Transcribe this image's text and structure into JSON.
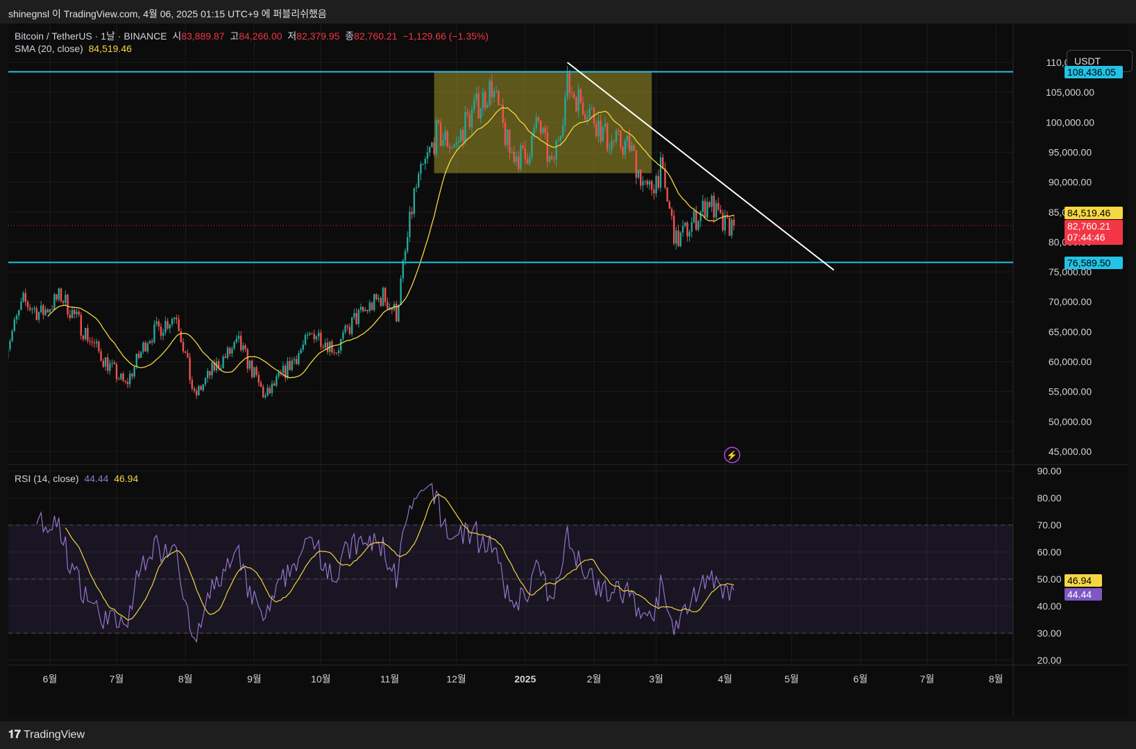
{
  "topbar": {
    "text": "shinegnsl 이 TradingView.com, 4월 06, 2025 01:15 UTC+9 에 퍼블리쉬했음"
  },
  "legend": {
    "symbol": "Bitcoin / TetherUS · 1날 · BINANCE",
    "o_label": "시",
    "o": "83,889.87",
    "h_label": "고",
    "h": "84,266.00",
    "l_label": "저",
    "l": "82,379.95",
    "c_label": "종",
    "c": "82,760.21",
    "change": "−1,129.66 (−1.35%)",
    "sma_label": "SMA (20, close)",
    "sma_value": "84,519.46",
    "rsi_label": "RSI (14, close)",
    "rsi_value": "44.44",
    "rsi_ma_value": "46.94"
  },
  "currency_button": "USDT",
  "price_tags": {
    "resistance": "108,436.05",
    "sma": "84,519.46",
    "last": "82,760.21",
    "countdown": "07:44:46",
    "support": "76,589.50",
    "rsi_ma": "46.94",
    "rsi": "44.44"
  },
  "bottom": {
    "brand": "TradingView"
  },
  "colors": {
    "up": "#26a69a",
    "down": "#ef5350",
    "sma": "#f5d742",
    "level": "#22c3e6",
    "rsi": "#9575cd",
    "last": "#f23645"
  },
  "chart_data": {
    "type": "candlestick",
    "title": "Bitcoin / TetherUS · 1날 · BINANCE",
    "price_ylim": [
      45000,
      110000
    ],
    "price_ticks": [
      "110,000.00",
      "105,000.00",
      "100,000.00",
      "95,000.00",
      "90,000.00",
      "85,000.00",
      "80,000.00",
      "75,000.00",
      "70,000.00",
      "65,000.00",
      "60,000.00",
      "55,000.00",
      "50,000.00",
      "45,000.00"
    ],
    "rsi_ylim": [
      20,
      90
    ],
    "rsi_ticks": [
      "90.00",
      "80.00",
      "70.00",
      "60.00",
      "50.00",
      "40.00",
      "30.00",
      "20.00"
    ],
    "x_ticks": [
      {
        "label": "6월",
        "date": "2024-06-01"
      },
      {
        "label": "7월",
        "date": "2024-07-01"
      },
      {
        "label": "8월",
        "date": "2024-08-01"
      },
      {
        "label": "9월",
        "date": "2024-09-01"
      },
      {
        "label": "10월",
        "date": "2024-10-01"
      },
      {
        "label": "11월",
        "date": "2024-11-01"
      },
      {
        "label": "12월",
        "date": "2024-12-01"
      },
      {
        "label": "2025",
        "date": "2025-01-01"
      },
      {
        "label": "2월",
        "date": "2025-02-01"
      },
      {
        "label": "3월",
        "date": "2025-03-01"
      },
      {
        "label": "4월",
        "date": "2025-04-01"
      },
      {
        "label": "5월",
        "date": "2025-05-01"
      },
      {
        "label": "6월",
        "date": "2025-06-01"
      },
      {
        "label": "7월",
        "date": "2025-07-01"
      },
      {
        "label": "8월",
        "date": "2025-08-01"
      }
    ],
    "approx_closes": [
      [
        "2024-05-12",
        62000
      ],
      [
        "2024-05-20",
        70000
      ],
      [
        "2024-05-28",
        68000
      ],
      [
        "2024-06-06",
        71000
      ],
      [
        "2024-06-14",
        66500
      ],
      [
        "2024-06-24",
        61000
      ],
      [
        "2024-07-05",
        56000
      ],
      [
        "2024-07-15",
        64000
      ],
      [
        "2024-07-28",
        68000
      ],
      [
        "2024-08-05",
        54000
      ],
      [
        "2024-08-14",
        59000
      ],
      [
        "2024-08-25",
        63000
      ],
      [
        "2024-09-06",
        54000
      ],
      [
        "2024-09-16",
        59000
      ],
      [
        "2024-09-28",
        65000
      ],
      [
        "2024-10-08",
        62000
      ],
      [
        "2024-10-16",
        67000
      ],
      [
        "2024-10-29",
        71000
      ],
      [
        "2024-11-04",
        68000
      ],
      [
        "2024-11-12",
        88000
      ],
      [
        "2024-11-22",
        98000
      ],
      [
        "2024-12-01",
        96000
      ],
      [
        "2024-12-05",
        100000
      ],
      [
        "2024-12-17",
        106000
      ],
      [
        "2024-12-25",
        95000
      ],
      [
        "2025-01-01",
        94000
      ],
      [
        "2025-01-07",
        100000
      ],
      [
        "2025-01-13",
        92000
      ],
      [
        "2025-01-20",
        106000
      ],
      [
        "2025-01-30",
        102000
      ],
      [
        "2025-02-07",
        97000
      ],
      [
        "2025-02-17",
        96000
      ],
      [
        "2025-02-25",
        88000
      ],
      [
        "2025-03-03",
        92000
      ],
      [
        "2025-03-10",
        80000
      ],
      [
        "2025-03-17",
        83000
      ],
      [
        "2025-03-25",
        87000
      ],
      [
        "2025-03-31",
        82500
      ],
      [
        "2025-04-05",
        82760.21
      ]
    ],
    "sma_period": 20,
    "rsi_period": 14,
    "horizontal_levels": [
      108436.05,
      76589.5
    ],
    "trendline": [
      [
        "2025-01-20",
        110000
      ],
      [
        "2025-05-20",
        75300
      ]
    ],
    "range_box": {
      "from": "2024-11-21",
      "to": "2025-02-27",
      "top": 108500,
      "bottom": 91500
    },
    "rsi_bands": [
      70,
      50,
      30
    ]
  }
}
